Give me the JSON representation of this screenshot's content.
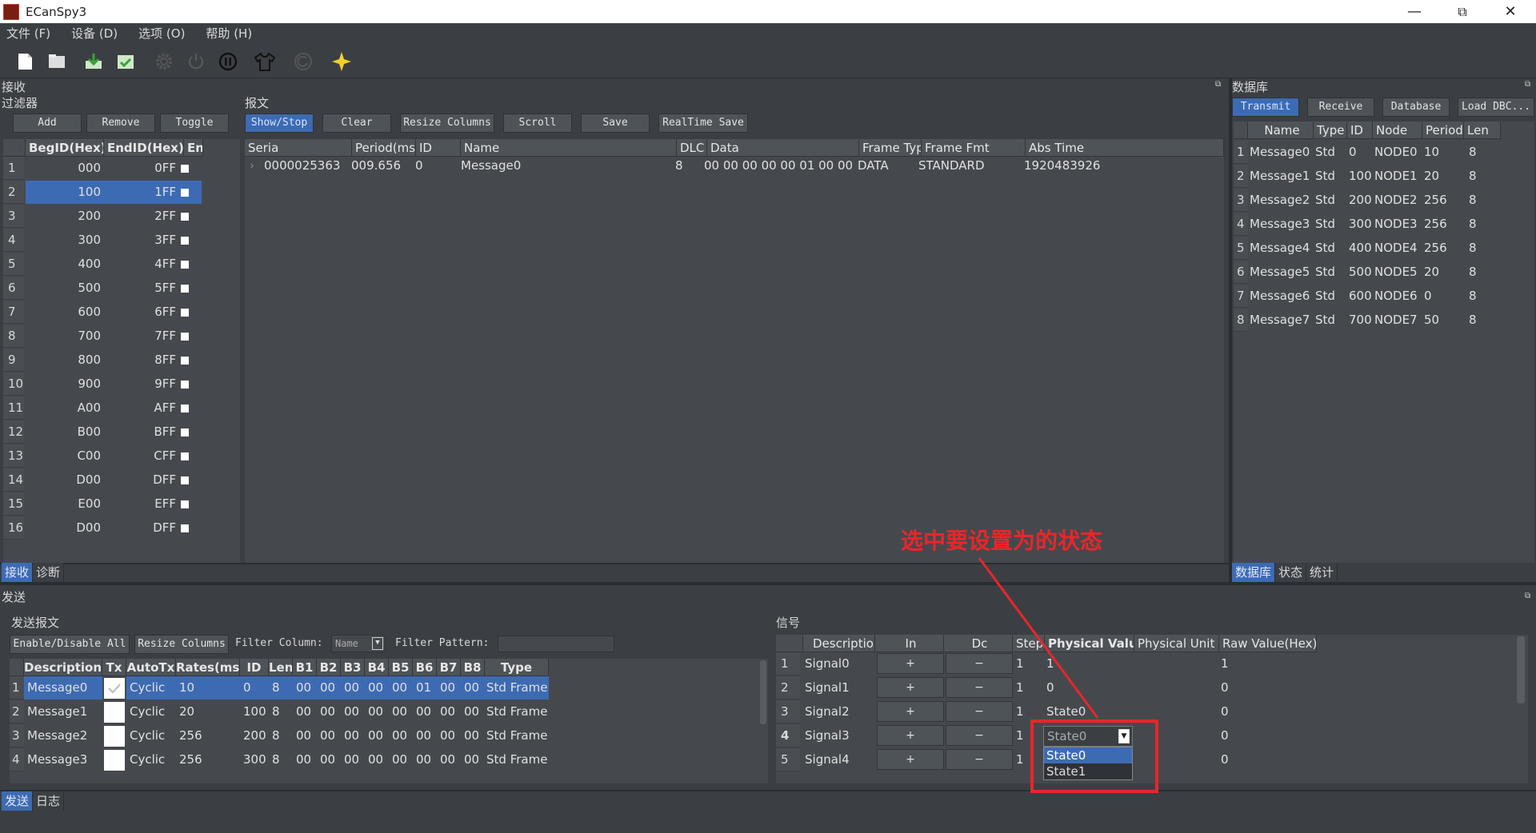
{
  "window": {
    "title": "ECanSpy3",
    "minimize": "—",
    "restore": "⧉",
    "close": "✕"
  },
  "menu": [
    "文件 (F)",
    "设备 (D)",
    "选项 (O)",
    "帮助 (H)"
  ],
  "toolbar_icons": [
    "new-file-icon",
    "open-folder-icon",
    "import-icon",
    "export-icon",
    "settings-gear-icon",
    "power-icon",
    "pause-icon",
    "shirt-icon",
    "refresh-icon",
    "star-icon"
  ],
  "receive": {
    "title": "接收",
    "filter": {
      "title": "过滤器",
      "buttons": [
        "Add",
        "Remove",
        "Toggle"
      ],
      "headers": [
        "BegID(Hex)",
        "EndID(Hex)",
        "En"
      ],
      "rows": [
        {
          "n": "1",
          "beg": "000",
          "end": "0FF"
        },
        {
          "n": "2",
          "beg": "100",
          "end": "1FF"
        },
        {
          "n": "3",
          "beg": "200",
          "end": "2FF"
        },
        {
          "n": "4",
          "beg": "300",
          "end": "3FF"
        },
        {
          "n": "5",
          "beg": "400",
          "end": "4FF"
        },
        {
          "n": "6",
          "beg": "500",
          "end": "5FF"
        },
        {
          "n": "7",
          "beg": "600",
          "end": "6FF"
        },
        {
          "n": "8",
          "beg": "700",
          "end": "7FF"
        },
        {
          "n": "9",
          "beg": "800",
          "end": "8FF"
        },
        {
          "n": "10",
          "beg": "900",
          "end": "9FF"
        },
        {
          "n": "11",
          "beg": "A00",
          "end": "AFF"
        },
        {
          "n": "12",
          "beg": "B00",
          "end": "BFF"
        },
        {
          "n": "13",
          "beg": "C00",
          "end": "CFF"
        },
        {
          "n": "14",
          "beg": "D00",
          "end": "DFF"
        },
        {
          "n": "15",
          "beg": "E00",
          "end": "EFF"
        },
        {
          "n": "16",
          "beg": "D00",
          "end": "DFF"
        }
      ],
      "selected_row": "2"
    },
    "messages": {
      "title": "报文",
      "buttons": [
        "Show/Stop",
        "Clear",
        "Resize Columns",
        "Scroll",
        "Save",
        "RealTime Save"
      ],
      "headers": [
        "Seria",
        "Period(ms",
        "ID",
        "Name",
        "DLC",
        "Data",
        "Frame Typ",
        "Frame Fmt",
        "Abs Time"
      ],
      "row": {
        "expander": "›",
        "serial": "0000025363",
        "period": "009.656",
        "id": "0",
        "name": "Message0",
        "dlc": "8",
        "data": "00 00 00 00 00 01 00 00",
        "frame_type": "DATA",
        "frame_fmt": "STANDARD",
        "abs_time": "1920483926"
      }
    },
    "tabs": [
      "接收",
      "诊断"
    ]
  },
  "database": {
    "title": "数据库",
    "buttons": [
      "Transmit",
      "Receive",
      "Database",
      "Load DBC..."
    ],
    "headers": [
      "Name",
      "Type",
      "ID",
      "Node",
      "Period",
      "Len"
    ],
    "rows": [
      {
        "n": "1",
        "name": "Message0",
        "type": "Std",
        "id": "0",
        "node": "NODE0",
        "period": "10",
        "len": "8"
      },
      {
        "n": "2",
        "name": "Message1",
        "type": "Std",
        "id": "100",
        "node": "NODE1",
        "period": "20",
        "len": "8"
      },
      {
        "n": "3",
        "name": "Message2",
        "type": "Std",
        "id": "200",
        "node": "NODE2",
        "period": "256",
        "len": "8"
      },
      {
        "n": "4",
        "name": "Message3",
        "type": "Std",
        "id": "300",
        "node": "NODE3",
        "period": "256",
        "len": "8"
      },
      {
        "n": "5",
        "name": "Message4",
        "type": "Std",
        "id": "400",
        "node": "NODE4",
        "period": "256",
        "len": "8"
      },
      {
        "n": "6",
        "name": "Message5",
        "type": "Std",
        "id": "500",
        "node": "NODE5",
        "period": "20",
        "len": "8"
      },
      {
        "n": "7",
        "name": "Message6",
        "type": "Std",
        "id": "600",
        "node": "NODE6",
        "period": "0",
        "len": "8"
      },
      {
        "n": "8",
        "name": "Message7",
        "type": "Std",
        "id": "700",
        "node": "NODE7",
        "period": "50",
        "len": "8"
      }
    ],
    "tabs": [
      "数据库",
      "状态",
      "统计"
    ]
  },
  "send": {
    "title": "发送",
    "tx_messages": {
      "title": "发送报文",
      "buttons": [
        "Enable/Disable All",
        "Resize Columns"
      ],
      "filter_column_label": "Filter Column:",
      "filter_column_value": "Name",
      "filter_pattern_label": "Filter Pattern:",
      "headers": [
        "Description",
        "Tx",
        "AutoTx",
        "Rates(ms)",
        "ID",
        "Len",
        "B1",
        "B2",
        "B3",
        "B4",
        "B5",
        "B6",
        "B7",
        "B8",
        "Type"
      ],
      "rows": [
        {
          "n": "1",
          "desc": "Message0",
          "auto": "Cyclic",
          "rate": "10",
          "id": "0",
          "len": "8",
          "b": [
            "00",
            "00",
            "00",
            "00",
            "00",
            "01",
            "00",
            "00"
          ],
          "type": "Std Frame",
          "checked": true
        },
        {
          "n": "2",
          "desc": "Message1",
          "auto": "Cyclic",
          "rate": "20",
          "id": "100",
          "len": "8",
          "b": [
            "00",
            "00",
            "00",
            "00",
            "00",
            "00",
            "00",
            "00"
          ],
          "type": "Std Frame",
          "checked": false
        },
        {
          "n": "3",
          "desc": "Message2",
          "auto": "Cyclic",
          "rate": "256",
          "id": "200",
          "len": "8",
          "b": [
            "00",
            "00",
            "00",
            "00",
            "00",
            "00",
            "00",
            "00"
          ],
          "type": "Std Frame",
          "checked": false
        },
        {
          "n": "4",
          "desc": "Message3",
          "auto": "Cyclic",
          "rate": "256",
          "id": "300",
          "len": "8",
          "b": [
            "00",
            "00",
            "00",
            "00",
            "00",
            "00",
            "00",
            "00"
          ],
          "type": "Std Frame",
          "checked": false
        }
      ]
    },
    "signals": {
      "title": "信号",
      "headers": [
        "Description",
        "In",
        "Dc",
        "Step",
        "Physical Value",
        "Physical Unit",
        "Raw Value(Hex)"
      ],
      "rows": [
        {
          "n": "1",
          "desc": "Signal0",
          "in": "+",
          "dc": "−",
          "step": "1",
          "phys": "1",
          "unit": "",
          "raw": "1"
        },
        {
          "n": "2",
          "desc": "Signal1",
          "in": "+",
          "dc": "−",
          "step": "1",
          "phys": "0",
          "unit": "",
          "raw": "0"
        },
        {
          "n": "3",
          "desc": "Signal2",
          "in": "+",
          "dc": "−",
          "step": "1",
          "phys": "State0",
          "unit": "",
          "raw": "0"
        },
        {
          "n": "4",
          "desc": "Signal3",
          "in": "+",
          "dc": "−",
          "step": "1",
          "phys": "State0",
          "unit": "",
          "raw": "0"
        },
        {
          "n": "5",
          "desc": "Signal4",
          "in": "+",
          "dc": "−",
          "step": "1",
          "phys": "",
          "unit": "",
          "raw": "0"
        }
      ],
      "dropdown": {
        "value": "State0",
        "options": [
          "State0",
          "State1"
        ]
      }
    },
    "tabs": [
      "发送",
      "日志"
    ]
  },
  "annotation": {
    "text": "选中要设置为的状态",
    "color": "#e8262a"
  },
  "colors": {
    "background": "#3b3f44",
    "panel": "#45494e",
    "selection": "#3d6bb3",
    "annotation": "#e8262a"
  }
}
